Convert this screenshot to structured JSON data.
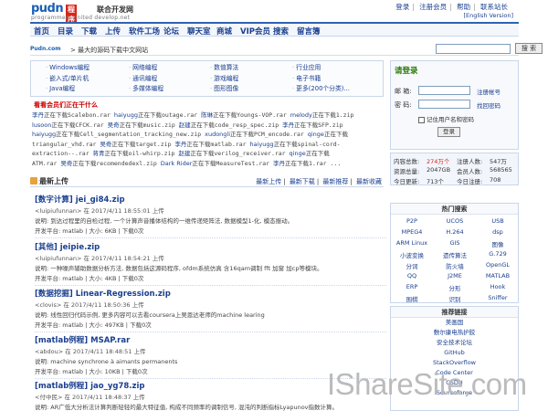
{
  "header": {
    "logo_text": "pudn",
    "logo_badge": "程序员",
    "logo_union": "联合开发网",
    "logo_sub": "programmers united develop.net",
    "top_links": [
      "登录",
      "注册会员",
      "帮助",
      "联系站长"
    ],
    "english": "[English Version]"
  },
  "nav": [
    "首页",
    "目录",
    "下载",
    "上传",
    "软件工场",
    "论坛",
    "聊天室",
    "商城",
    "VIP会员",
    "搜索",
    "留言簿"
  ],
  "searchbar": {
    "logo": "Pudn.com",
    "title": "> 最大的源码下载中文网站",
    "button": "搜 索"
  },
  "categories": [
    [
      "Windows编程",
      "嵌入式/单片机",
      "Java编程"
    ],
    [
      "网络编程",
      "通讯编程",
      "多媒体编程"
    ],
    [
      "数值算法",
      "游戏编程",
      "图形图像"
    ],
    [
      "行业应用",
      "电子书籍",
      "更多(200个分类)..."
    ]
  ],
  "hot": {
    "title": "看看会员们正在干什么",
    "lines": [
      [
        [
          "李丹",
          "正在下载"
        ],
        [
          "Scalebon.rar"
        ],
        [
          "haiyugg",
          "正在下载"
        ],
        [
          "outage.rar"
        ],
        [
          "陈琳",
          "正在下载"
        ],
        [
          "Youngs-VOP.rar"
        ],
        [
          "melody",
          "正在下载"
        ],
        [
          "1.zip"
        ]
      ],
      [
        [
          "lusoon",
          "正在下载"
        ],
        [
          "CFCK.rar"
        ],
        [
          "吴奇",
          "正在下载"
        ],
        [
          "music.zip"
        ],
        [
          "赵建",
          "正在下载"
        ],
        [
          "code_resp_spec.zip"
        ],
        [
          "李丹",
          "正在下载"
        ],
        [
          "SFP.zip"
        ]
      ],
      [
        [
          "haiyugg",
          "正在下载"
        ],
        [
          "Cell_segmentation_tracking_new.zip"
        ],
        [
          "xudongli",
          "正在下载"
        ],
        [
          "PCM_encode.rar"
        ],
        [
          "qinge",
          "正在下载"
        ]
      ],
      [
        [
          "",
          ""
        ],
        [
          "triangular_vhd.rar"
        ],
        [
          "吴奇",
          "正在下载"
        ],
        [
          "target.zip"
        ],
        [
          "李丹",
          "正在下载"
        ],
        [
          "matlab.rar"
        ],
        [
          "haiyugg",
          "正在下载"
        ],
        [
          "spinal-cord-"
        ]
      ],
      [
        [
          "",
          ""
        ],
        [
          "extraction--.rar"
        ],
        [
          "蒋青",
          "正在下载"
        ],
        [
          "oil-whirp.zip"
        ],
        [
          "赵建",
          "正在下载"
        ],
        [
          "verilog_receiver.rar"
        ],
        [
          "qinge",
          "正在下载"
        ]
      ],
      [
        [
          "",
          ""
        ],
        [
          "ATM.rar"
        ],
        [
          "吴奇",
          "正在下载"
        ],
        [
          "recomendedexl.zip"
        ],
        [
          "Dark Rider",
          "正在下载"
        ],
        [
          "MeasureTest.rar"
        ],
        [
          "李丹",
          "正在下载"
        ],
        [
          "1.rar"
        ],
        [
          "",
          "..."
        ]
      ]
    ]
  },
  "latest": {
    "title": "最新上传",
    "tabs": [
      "最新上传",
      "最新下载",
      "最新推荐",
      "最新收藏"
    ],
    "entries": [
      {
        "title": "[数字计算] jei_gi84.zip",
        "meta": "<luipiufunnan> 在 2017/4/11 18:55:01 上传",
        "desc": "说明: 到达过程里的自检过程, 一个计算声音播体结构的一维传递矩阵法, 数据模型1-化, 模态振动。",
        "platform": "开发平台: matlab | 大小: 6KB | 下载0次"
      },
      {
        "title": "[其他] jeipie.zip",
        "meta": "<luipiufunnan> 在 2017/4/11 18:54:21 上传",
        "desc": "说明: 一种噪声辅助数据分析方法, 数据包括这源码程序, ofdm系统仿真 含16qam调制 fft 加窗 加cp等模块。",
        "platform": "开发平台: matlab | 大小: 4KB | 下载0次"
      },
      {
        "title": "[数据挖掘] Linear-Regression.zip",
        "meta": "<clovis> 在 2017/4/11 18:50:36 上传",
        "desc": "说明: 线性回归代码示例, 更多内容可以去看coursera上吴恩达老师的machine learing",
        "platform": "开发平台: matlab | 大小: 497KB | 下载0次"
      },
      {
        "title": "[matlab例程] MSAP.rar",
        "meta": "<abdou> 在 2017/4/11 18:48:51 上传",
        "desc": "说明: machine synchrone à aimants permanents",
        "platform": "开发平台: matlab | 大小: 10KB | 下载0次"
      },
      {
        "title": "[matlab例程] jao_yg78.zip",
        "meta": "<付中民> 在 2017/4/11 18:48:37 上传",
        "desc": "说明: AR广低大分析法计算判断轻轻的最大特征值, 构成不同频率的调制信号, 混沌的判断指标Lyapunov指数计算。",
        "platform": ""
      }
    ]
  },
  "login": {
    "title": "请登录",
    "email_label": "邮  箱:",
    "password_label": "密  码:",
    "register": "注册帐号",
    "forgot": "找回密码",
    "remember": "记住用户名和密码",
    "button": "登录"
  },
  "stats": [
    {
      "label": "内容总数:",
      "value": "274万个"
    },
    {
      "label": "注册人数:",
      "value": "547万"
    },
    {
      "label": "资源总量:",
      "value": "2047GB"
    },
    {
      "label": "会员人数:",
      "value": "568565"
    },
    {
      "label": "今日更新:",
      "value": "713个"
    },
    {
      "label": "今日注册:",
      "value": "708"
    }
  ],
  "hot_search": {
    "title": "热门搜索",
    "items": [
      "P2P",
      "UCOS",
      "USB",
      "MPEG4",
      "H.264",
      "dsp",
      "ARM Linux",
      "GIS",
      "图像",
      "小波变换",
      "遗传算法",
      "G.729",
      "分词",
      "防火墙",
      "OpenGL",
      "QQ",
      "J2ME",
      "MATLAB",
      "ERP",
      "分形",
      "Hook",
      "围棋",
      "识别",
      "Sniffer"
    ]
  },
  "friends": {
    "title": "推荐链接",
    "items": [
      "美画国",
      "敷尔康电热护胶",
      "安全技术论坛",
      "GitHub",
      "StackOverflow",
      "Code Center",
      "CSDN",
      "Sourceforge"
    ]
  },
  "watermark": "IShareSite.com"
}
